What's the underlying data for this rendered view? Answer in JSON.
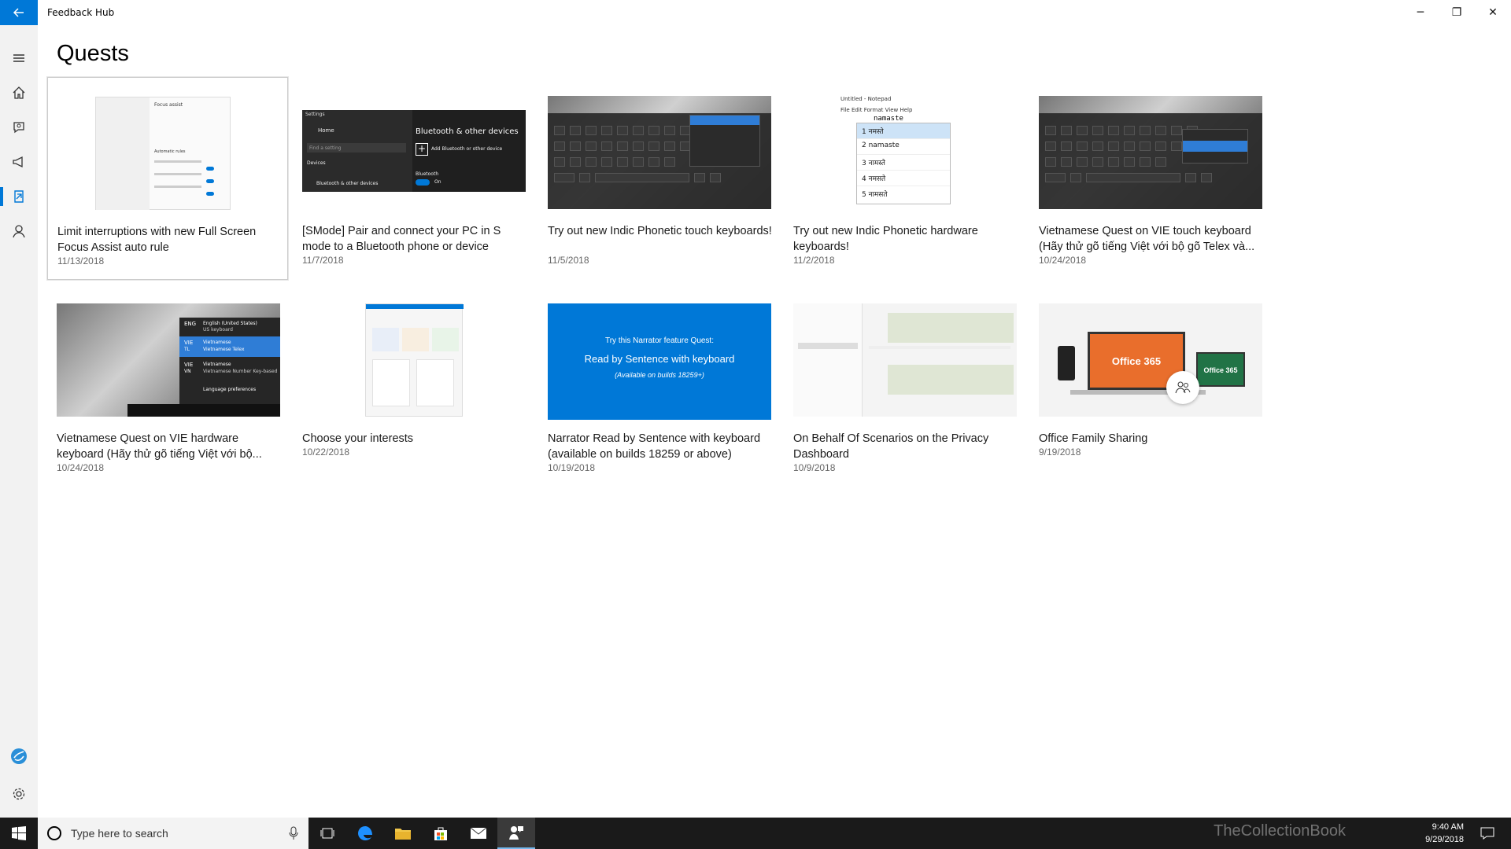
{
  "window": {
    "title": "Feedback Hub",
    "controls": {
      "minimize": "─",
      "restore": "❐",
      "close": "✕"
    }
  },
  "page": {
    "title": "Quests"
  },
  "quests": [
    {
      "title": "Limit interruptions with new Full Screen Focus Assist auto rule",
      "date": "11/13/2018"
    },
    {
      "title": "[SMode] Pair and connect your PC in S mode to a Bluetooth phone or device",
      "date": "11/7/2018"
    },
    {
      "title": "Try out new Indic Phonetic touch keyboards!",
      "date": "11/5/2018"
    },
    {
      "title": "Try out new Indic Phonetic hardware keyboards!",
      "date": "11/2/2018"
    },
    {
      "title": "Vietnamese Quest on VIE touch keyboard (Hãy thử gõ tiếng Việt với bộ gõ Telex và...",
      "date": "10/24/2018"
    },
    {
      "title": "Vietnamese Quest on VIE hardware keyboard (Hãy thử gõ tiếng Việt với bộ...",
      "date": "10/24/2018"
    },
    {
      "title": "Choose your interests",
      "date": "10/22/2018"
    },
    {
      "title": "Narrator Read by Sentence with keyboard (available on builds 18259 or above)",
      "date": "10/19/2018"
    },
    {
      "title": "On Behalf Of Scenarios on the Privacy Dashboard",
      "date": "10/9/2018"
    },
    {
      "title": "Office Family Sharing",
      "date": "9/19/2018"
    }
  ],
  "thumbs": {
    "settings": {
      "heading": "Focus assist",
      "sub": "Automatic rules"
    },
    "bluetooth": {
      "settings": "Settings",
      "home": "Home",
      "find": "Find a setting",
      "devices": "Devices",
      "bt_devices": "Bluetooth & other devices",
      "panel_title": "Bluetooth & other devices",
      "add": "Add Bluetooth or other device",
      "bt": "Bluetooth",
      "on": "On"
    },
    "notepad": {
      "title": "Untitled - Notepad",
      "menu": "File  Edit  Format  View  Help",
      "typed": "namaste",
      "candidates": [
        "1  नमस्ते",
        "2  namaste",
        "3  नामस्ते",
        "4  नमसते",
        "5  नामसते"
      ]
    },
    "narrator": {
      "line1": "Try this Narrator feature Quest:",
      "line2": "Read by Sentence with keyboard",
      "line3": "(Available on builds 18259+)"
    },
    "vie_popup": {
      "eng": "ENG",
      "eng_label": "English (United States)",
      "eng_sub": "US keyboard",
      "vie": "VIE",
      "tl": "TL",
      "vie_label": "Vietnamese",
      "vie_sub": "Vietnamese Telex",
      "vn": "VN",
      "vie_sub2": "Vietnamese Number Key-based",
      "prefs": "Language preferences"
    },
    "office": {
      "main": "Office 365",
      "small": "Office 365"
    }
  },
  "taskbar": {
    "search_placeholder": "Type here to search",
    "time": "9:40 AM",
    "date": "9/29/2018",
    "watermark": "TheCollectionBook"
  },
  "colors": {
    "accent": "#0078d7",
    "taskbar": "#1a1a1a",
    "rail": "#f2f2f2"
  }
}
